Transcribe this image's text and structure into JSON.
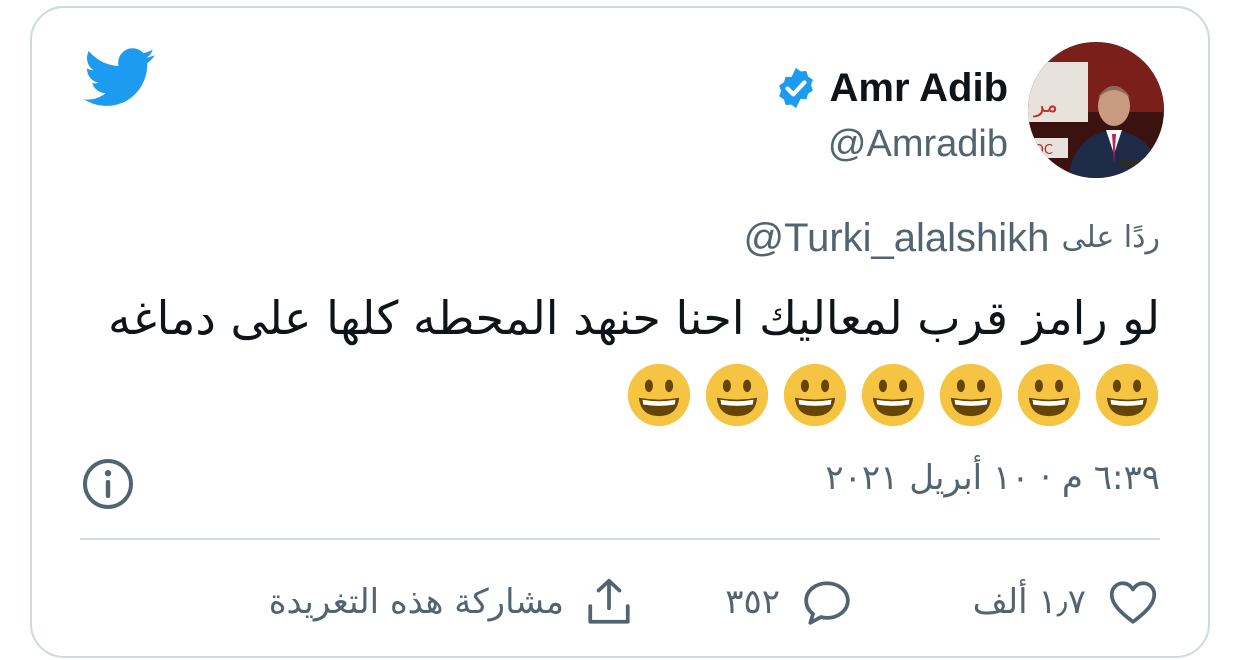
{
  "author": {
    "display_name": "Amr Adib",
    "handle": "@Amradib",
    "verified": true
  },
  "reply": {
    "prefix": "ردًا على",
    "handle": "@Turki_alalshikh"
  },
  "tweet": {
    "text": "لو رامز قرب لمعاليك احنا حنهد المحطه كلها على دماغه",
    "emojis": [
      "grinning-face-emoji",
      "grinning-face-emoji",
      "grinning-face-emoji",
      "grinning-face-emoji",
      "grinning-face-emoji",
      "grinning-face-emoji",
      "grinning-face-emoji"
    ]
  },
  "meta": {
    "timestamp": "٦:٣٩ م · ١٠ أبريل ٢٠٢١"
  },
  "actions": {
    "likes": "١٫٧ ألف",
    "replies": "٣٥٢",
    "share_label": "مشاركة هذه التغريدة"
  },
  "colors": {
    "brand_blue": "#1d9bf0",
    "text_primary": "#0f1419",
    "text_secondary": "#536471",
    "border": "#cfd9de",
    "emoji_yellow": "#f5c443"
  },
  "icons": [
    "twitter-bird-icon",
    "verified-badge-icon",
    "info-icon",
    "heart-icon",
    "reply-bubble-icon",
    "share-icon"
  ]
}
